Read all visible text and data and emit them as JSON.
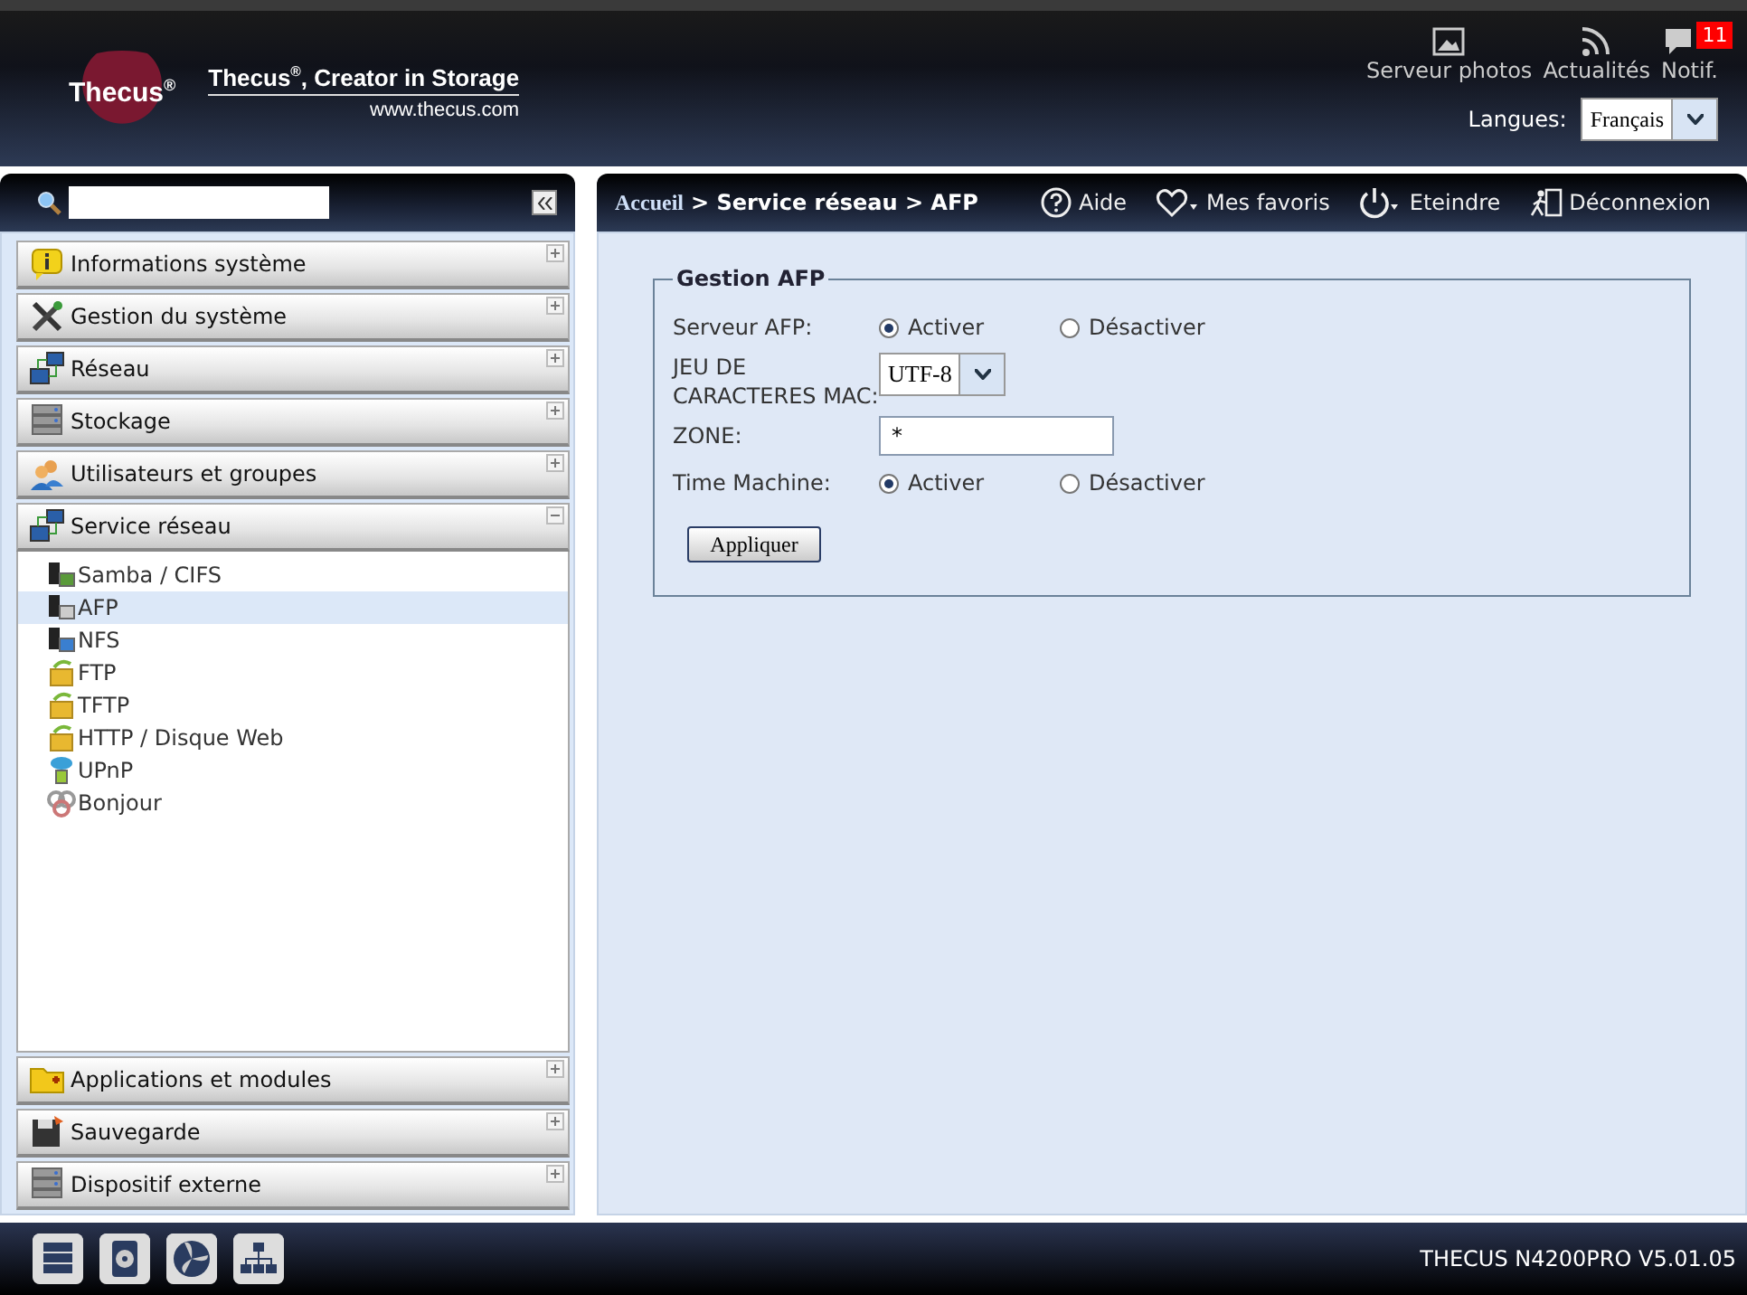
{
  "header": {
    "logo": "Thecus$^{®}$",
    "tagline": "Thecus$^{®}$, Creator in Storage",
    "website": "www.thecus.com",
    "shortcuts": [
      {
        "kind": "photo",
        "label": "Serveur photos"
      },
      {
        "kind": "rss",
        "label": "Actualités"
      },
      {
        "kind": "notif",
        "label": "Notif.",
        "badge": "11"
      }
    ],
    "language_label": "Langues:",
    "language": "Français"
  },
  "sidebar": {
    "sections_top": [
      {
        "label": "Informations système",
        "expanded": false
      },
      {
        "label": "Gestion du système",
        "expanded": false
      },
      {
        "label": "Réseau",
        "expanded": false
      },
      {
        "label": "Stockage",
        "expanded": false
      },
      {
        "label": "Utilisateurs et groupes",
        "expanded": false
      },
      {
        "label": "Service réseau",
        "expanded": true,
        "children": [
          {
            "label": "Samba / CIFS",
            "selected": false
          },
          {
            "label": "AFP",
            "selected": true
          },
          {
            "label": "NFS",
            "selected": false
          },
          {
            "label": "FTP",
            "selected": false
          },
          {
            "label": "TFTP",
            "selected": false
          },
          {
            "label": "HTTP / Disque Web",
            "selected": false
          },
          {
            "label": "UPnP",
            "selected": false
          },
          {
            "label": "Bonjour",
            "selected": false
          }
        ]
      }
    ],
    "sections_bottom": [
      {
        "label": "Applications et modules",
        "expanded": false
      },
      {
        "label": "Sauvegarde",
        "expanded": false
      },
      {
        "label": "Dispositif externe",
        "expanded": false
      }
    ]
  },
  "breadcrumb": {
    "home": "Accueil",
    "path": "> Service réseau > AFP"
  },
  "toolbar": [
    {
      "kind": "help",
      "label": "Aide"
    },
    {
      "kind": "favorites",
      "label": "Mes favoris"
    },
    {
      "kind": "power",
      "label": "Eteindre"
    },
    {
      "kind": "logout",
      "label": "Déconnexion"
    }
  ],
  "form": {
    "title": "Gestion AFP",
    "rows": [
      {
        "kind": "radio",
        "label": "Serveur AFP:",
        "options": [
          {
            "label": "Activer",
            "selected": true
          },
          {
            "label": "Désactiver",
            "selected": false
          }
        ]
      },
      {
        "kind": "select",
        "label": "JEU DE CARACTERES MAC:",
        "value": "UTF-8"
      },
      {
        "kind": "text",
        "label": "ZONE:",
        "value": "*"
      },
      {
        "kind": "radio",
        "label": "Time Machine:",
        "options": [
          {
            "label": "Activer",
            "selected": true
          },
          {
            "label": "Désactiver",
            "selected": false
          }
        ]
      }
    ],
    "button": "Appliquer"
  },
  "status_bar": {
    "model": "THECUS N4200PRO V5.01.05"
  }
}
